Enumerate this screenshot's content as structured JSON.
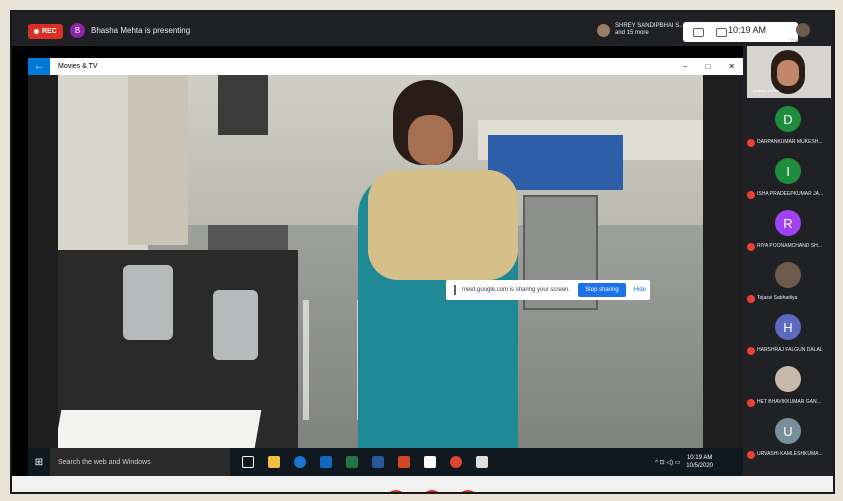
{
  "meet": {
    "rec_label": "REC",
    "presenter_initial": "B",
    "presenter_text": "Bhasha Mehta is presenting",
    "participants_line1": "SHREY SANDIPBHAI S...",
    "participants_line2": "and 15 more",
    "clock": "10:19 AM",
    "self_label": "You"
  },
  "window": {
    "back": "←",
    "title": "Movies & TV",
    "minimize": "–",
    "maximize": "□",
    "close": "✕"
  },
  "share_bar": {
    "text": "meet.google.com is sharing your screen.",
    "stop": "Stop sharing",
    "hide": "Hide"
  },
  "taskbar": {
    "start": "⊞",
    "search_placeholder": "Search the web and Windows",
    "time": "10:19 AM",
    "date": "10/5/2020",
    "tray_icons": "^ ⊡ ◁) ▭"
  },
  "sidebar": {
    "top_tile_label": "Bhasha Mehta",
    "participants": [
      {
        "initial": "D",
        "name": "DARPANKUMAR MUKESH...",
        "color": "#1e8e3e"
      },
      {
        "initial": "I",
        "name": "ISHA PRADEEPKUMAR JA...",
        "color": "#1e8e3e"
      },
      {
        "initial": "R",
        "name": "RIYA POONAMCHAND SH...",
        "color": "#a142f4"
      },
      {
        "initial": "",
        "name": "Tejasvi Sabhadiya",
        "color": "#6d5b4c"
      },
      {
        "initial": "H",
        "name": "HARSHRAJ FALGUN DALAL",
        "color": "#5c6bc0"
      },
      {
        "initial": "",
        "name": "HET BHAVIKKUMAR GAN...",
        "color": "#c9b8a8"
      },
      {
        "initial": "U",
        "name": "URVASHI KAMLESHKUMA...",
        "color": "#78909c"
      }
    ]
  }
}
